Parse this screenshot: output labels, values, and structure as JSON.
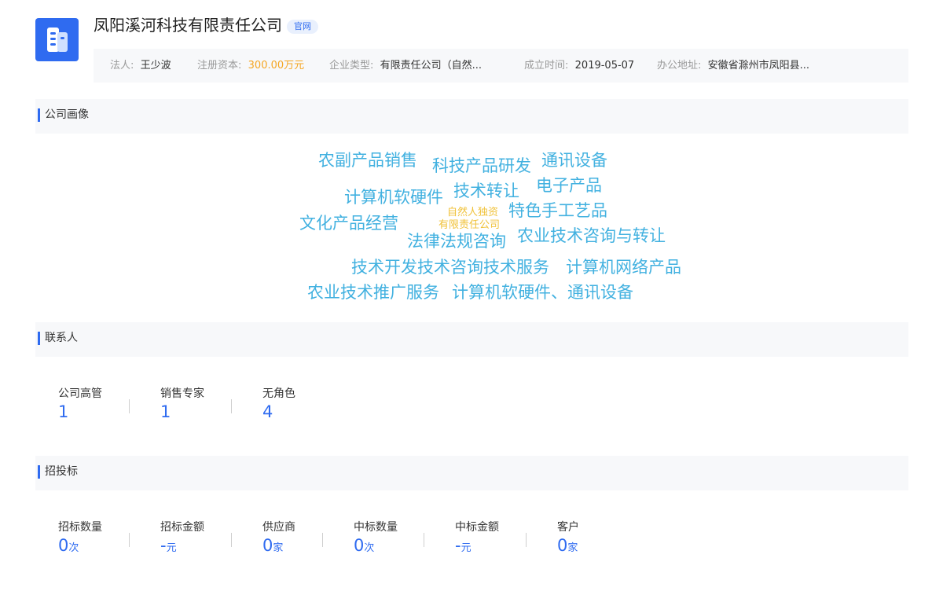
{
  "company": {
    "name": "凤阳溪河科技有限责任公司",
    "official_tag": "官网",
    "logo_icon": "building-icon",
    "accent_color": "#2f6bf0"
  },
  "info": [
    {
      "label": "法人:",
      "value": "王少波"
    },
    {
      "label": "注册资本:",
      "value": "300.00万元",
      "color": "#f5a623"
    },
    {
      "label": "企业类型:",
      "value": "有限责任公司（自然..."
    },
    {
      "label": "成立时间:",
      "value": "2019-05-07"
    },
    {
      "label": "办公地址:",
      "value": "安徽省滁州市凤阳县..."
    }
  ],
  "portrait": {
    "title": "公司画像",
    "word_colors": {
      "primary": "#42b1e0",
      "accent": "#f0c23a"
    },
    "words": [
      "农副产品销售",
      "科技产品研发",
      "通讯设备",
      "计算机软硬件",
      "技术转让",
      "电子产品",
      "自然人独资",
      "特色手工艺品",
      "文化产品经营",
      "有限责任公司",
      "法律法规咨询",
      "农业技术咨询与转让",
      "技术开发技术咨询技术服务",
      "计算机网络产品",
      "农业技术推广服务",
      "计算机软硬件、通讯设备"
    ]
  },
  "contacts": {
    "title": "联系人",
    "stats": [
      {
        "label": "公司高管",
        "value": "1"
      },
      {
        "label": "销售专家",
        "value": "1"
      },
      {
        "label": "无角色",
        "value": "4"
      }
    ]
  },
  "bidding": {
    "title": "招投标",
    "stats": [
      {
        "label": "招标数量",
        "value": "0",
        "unit": "次"
      },
      {
        "label": "招标金额",
        "value": "-",
        "unit": "元"
      },
      {
        "label": "供应商",
        "value": "0",
        "unit": "家"
      },
      {
        "label": "中标数量",
        "value": "0",
        "unit": "次"
      },
      {
        "label": "中标金额",
        "value": "-",
        "unit": "元"
      },
      {
        "label": "客户",
        "value": "0",
        "unit": "家"
      }
    ]
  }
}
